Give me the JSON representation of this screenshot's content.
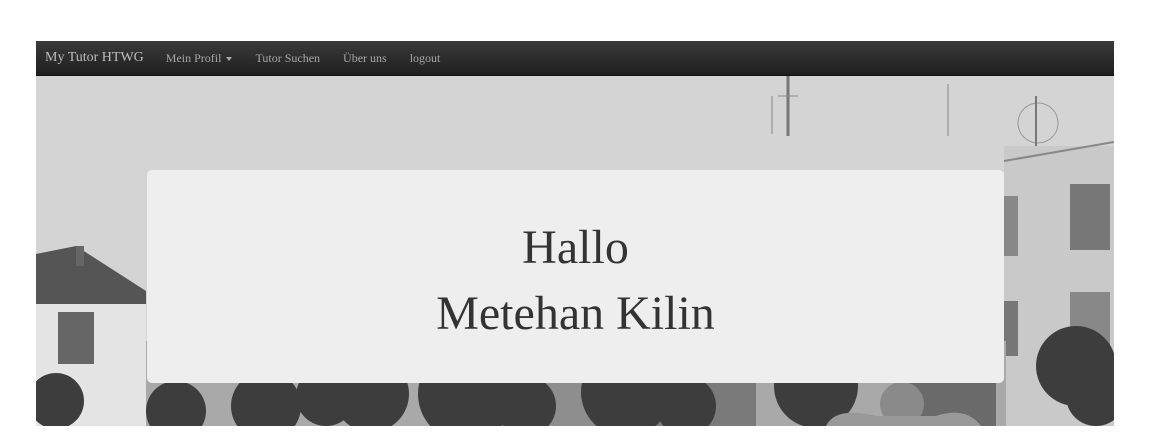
{
  "navbar": {
    "brand": "My Tutor HTWG",
    "items": [
      {
        "label": "Mein Profil",
        "has_dropdown": true
      },
      {
        "label": "Tutor Suchen"
      },
      {
        "label": "Über uns"
      },
      {
        "label": "logout"
      }
    ]
  },
  "hero": {
    "background": "grayscale campus building photo",
    "greeting_line1": "Hallo",
    "greeting_line2": "Metehan Kilin"
  },
  "colors": {
    "navbar_bg": "#222222",
    "nav_text": "#a8a8a8",
    "jumbotron_bg": "#eeeeee",
    "heading_text": "#333333"
  }
}
